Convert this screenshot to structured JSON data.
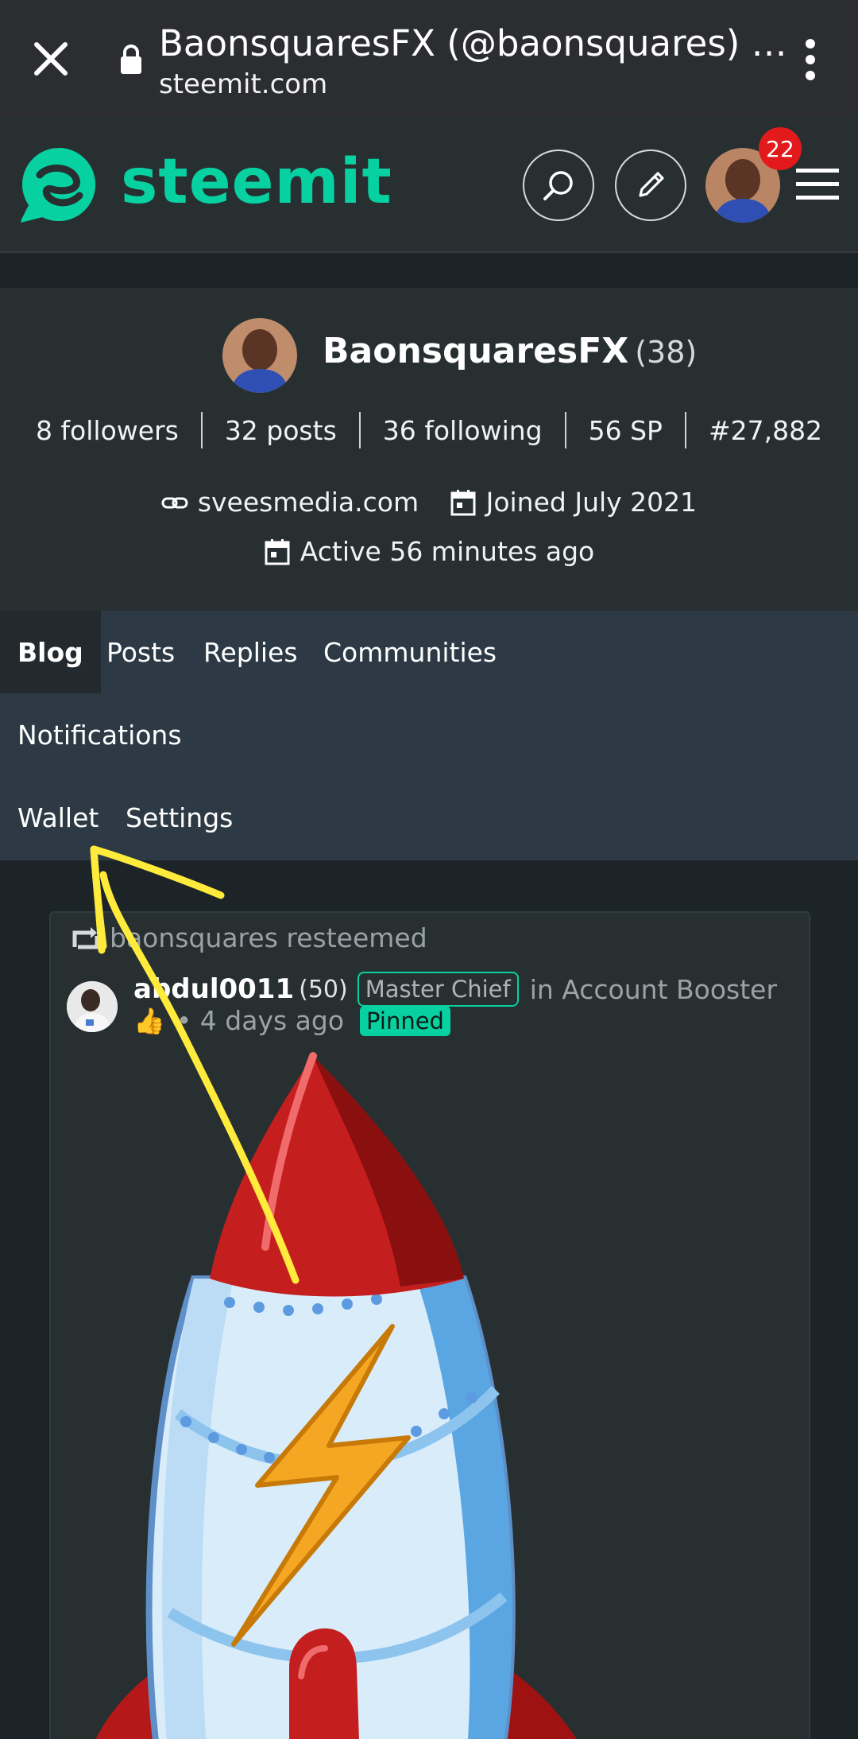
{
  "browser": {
    "title": "BaonsquaresFX (@baonsquares) …",
    "url": "steemit.com",
    "close_icon": "close-icon",
    "lock_icon": "lock-icon",
    "menu_icon": "more-vert-icon"
  },
  "header": {
    "logo_text": "steemit",
    "brand_color": "#07d1a1",
    "notification_count": "22",
    "icons": [
      "search-icon",
      "pencil-icon",
      "avatar",
      "hamburger-icon"
    ]
  },
  "profile": {
    "name": "BaonsquaresFX",
    "reputation": "(38)",
    "stats": {
      "followers": "8 followers",
      "posts": "32 posts",
      "following": "36 following",
      "sp": "56 SP",
      "rank": "#27,882"
    },
    "website": "sveesmedia.com",
    "joined": "Joined July 2021",
    "active": "Active 56 minutes ago"
  },
  "tabs": {
    "blog": "Blog",
    "posts": "Posts",
    "replies": "Replies",
    "communities": "Communities",
    "notifications": "Notifications",
    "wallet": "Wallet",
    "settings": "Settings",
    "active": "Blog"
  },
  "post": {
    "resteem_text": "baonsquares resteemed",
    "author": "abdul0011",
    "author_rep": "(50)",
    "role": "Master Chief",
    "community": "in Account Booster",
    "thumb": "👍",
    "time": "• 4 days ago",
    "pinned": "Pinned"
  },
  "annotation_color": "#ffeb3b"
}
